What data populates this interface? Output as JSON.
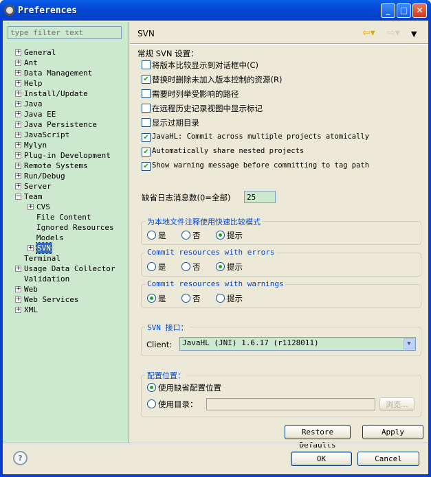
{
  "window": {
    "title": "Preferences",
    "minimize": "_",
    "maximize": "□",
    "close": "✕"
  },
  "sidebar": {
    "filter_placeholder": "type filter text",
    "items": [
      {
        "label": "General",
        "expander": "+"
      },
      {
        "label": "Ant",
        "expander": "+"
      },
      {
        "label": "Data Management",
        "expander": "+"
      },
      {
        "label": "Help",
        "expander": "+"
      },
      {
        "label": "Install/Update",
        "expander": "+"
      },
      {
        "label": "Java",
        "expander": "+"
      },
      {
        "label": "Java EE",
        "expander": "+"
      },
      {
        "label": "Java Persistence",
        "expander": "+"
      },
      {
        "label": "JavaScript",
        "expander": "+"
      },
      {
        "label": "Mylyn",
        "expander": "+"
      },
      {
        "label": "Plug-in Development",
        "expander": "+"
      },
      {
        "label": "Remote Systems",
        "expander": "+"
      },
      {
        "label": "Run/Debug",
        "expander": "+"
      },
      {
        "label": "Server",
        "expander": "+"
      },
      {
        "label": "Team",
        "expander": "−"
      },
      {
        "label": "CVS",
        "expander": "+",
        "child": true
      },
      {
        "label": "File Content",
        "child": true
      },
      {
        "label": "Ignored Resources",
        "child": true
      },
      {
        "label": "Models",
        "child": true
      },
      {
        "label": "SVN",
        "expander": "+",
        "child": true,
        "selected": true
      },
      {
        "label": "Terminal"
      },
      {
        "label": "Usage Data Collector",
        "expander": "+"
      },
      {
        "label": "Validation"
      },
      {
        "label": "Web",
        "expander": "+"
      },
      {
        "label": "Web Services",
        "expander": "+"
      },
      {
        "label": "XML",
        "expander": "+"
      }
    ]
  },
  "page": {
    "title": "SVN",
    "general_label": "常规 SVN 设置：",
    "checkboxes": [
      {
        "label": "将版本比较显示到对话框中(C)",
        "checked": false
      },
      {
        "label": "替换时删除未加入版本控制的资源(R)",
        "checked": true
      },
      {
        "label": "需要时列举受影响的路径",
        "checked": false
      },
      {
        "label": "在远程历史记录视图中显示标记",
        "checked": false
      },
      {
        "label": "显示过期目录",
        "checked": false
      },
      {
        "label": "JavaHL: Commit across multiple projects atomically",
        "checked": true,
        "mono": true
      },
      {
        "label": "Automatically share nested projects",
        "checked": true,
        "mono": true
      },
      {
        "label": "Show warning message before committing to tag path",
        "checked": true,
        "mono": true
      }
    ],
    "log_count_label": "缺省日志消息数(0=全部)",
    "log_count_value": "25",
    "radio_groups": [
      {
        "legend": "为本地文件注释使用快速比较模式",
        "options": [
          "是",
          "否",
          "提示"
        ],
        "selected": 2
      },
      {
        "legend": "Commit resources with errors",
        "options": [
          "是",
          "否",
          "提示"
        ],
        "selected": 2
      },
      {
        "legend": "Commit resources with warnings",
        "options": [
          "是",
          "否",
          "提示"
        ],
        "selected": 0
      }
    ],
    "interface": {
      "legend": "SVN 接口：",
      "client_label": "Client:",
      "client_value": "JavaHL (JNI) 1.6.17 (r1128011)"
    },
    "config": {
      "legend": "配置位置：",
      "default_label": "使用缺省配置位置",
      "dir_label": "使用目录：",
      "dir_value": "",
      "browse_label": "浏览...",
      "selected": 0
    },
    "restore_defaults": "Restore Defaults",
    "apply": "Apply"
  },
  "footer": {
    "ok": "OK",
    "cancel": "Cancel",
    "help": "?"
  }
}
